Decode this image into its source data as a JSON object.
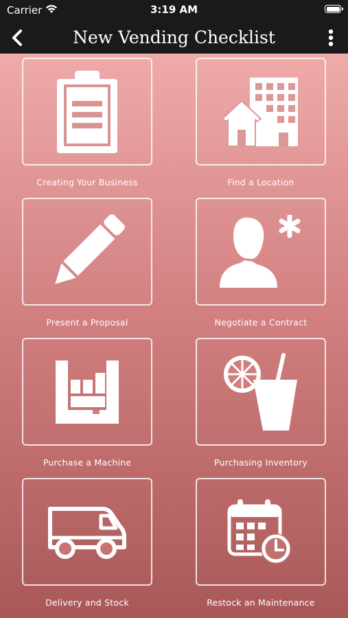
{
  "status_bar": {
    "carrier": "Carrier",
    "time": "3:19 AM"
  },
  "nav": {
    "title": "New Vending Checklist"
  },
  "tiles": [
    {
      "label": "Creating Your Business",
      "icon": "clipboard-icon"
    },
    {
      "label": "Find a Location",
      "icon": "buildings-icon"
    },
    {
      "label": "Present a Proposal",
      "icon": "pencil-icon"
    },
    {
      "label": "Negotiate a Contract",
      "icon": "person-icon"
    },
    {
      "label": "Purchase a Machine",
      "icon": "vending-machine-icon"
    },
    {
      "label": "Purchasing Inventory",
      "icon": "drink-icon"
    },
    {
      "label": "Delivery and Stock",
      "icon": "delivery-van-icon"
    },
    {
      "label": "Restock an Maintenance",
      "icon": "calendar-clock-icon"
    }
  ],
  "colors": {
    "bar": "#1a1a1a",
    "gradient_top": "#efaaaa",
    "gradient_bottom": "#a95858",
    "icon": "#ffffff"
  }
}
